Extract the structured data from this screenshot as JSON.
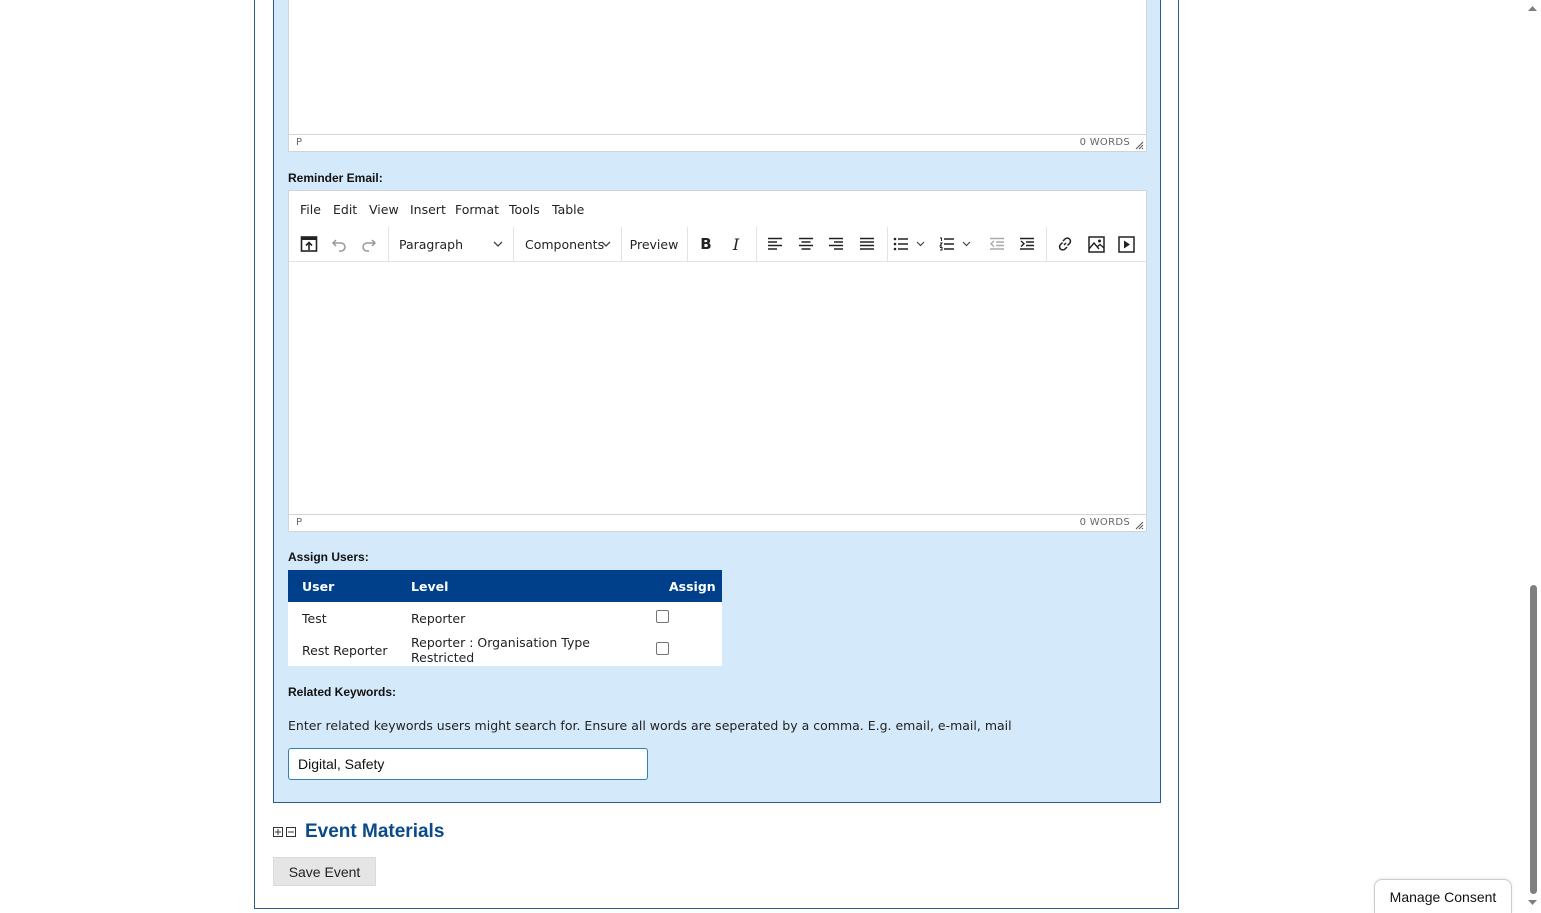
{
  "editor_top": {
    "status_path": "P",
    "word_count": "0 WORDS"
  },
  "reminder": {
    "label": "Reminder Email:",
    "menu": [
      "File",
      "Edit",
      "View",
      "Insert",
      "Format",
      "Tools",
      "Table"
    ],
    "block_format": "Paragraph",
    "components": "Components",
    "preview": "Preview",
    "bold": "B",
    "italic": "I",
    "status_path": "P",
    "word_count": "0 WORDS"
  },
  "assign": {
    "label": "Assign Users:",
    "headers": [
      "User",
      "Level",
      "Assign"
    ],
    "rows": [
      {
        "user": "Test",
        "level": "Reporter",
        "checked": false
      },
      {
        "user": "Rest Reporter",
        "level": "Reporter : Organisation Type Restricted",
        "checked": false
      }
    ]
  },
  "keywords": {
    "label": "Related Keywords:",
    "help": "Enter related keywords users might search for. Ensure all words are seperated by a comma. E.g. email, e-mail, mail",
    "value": "Digital, Safety"
  },
  "event_materials": {
    "title": "Event Materials"
  },
  "save_label": "Save Event",
  "consent_label": "Manage Consent"
}
